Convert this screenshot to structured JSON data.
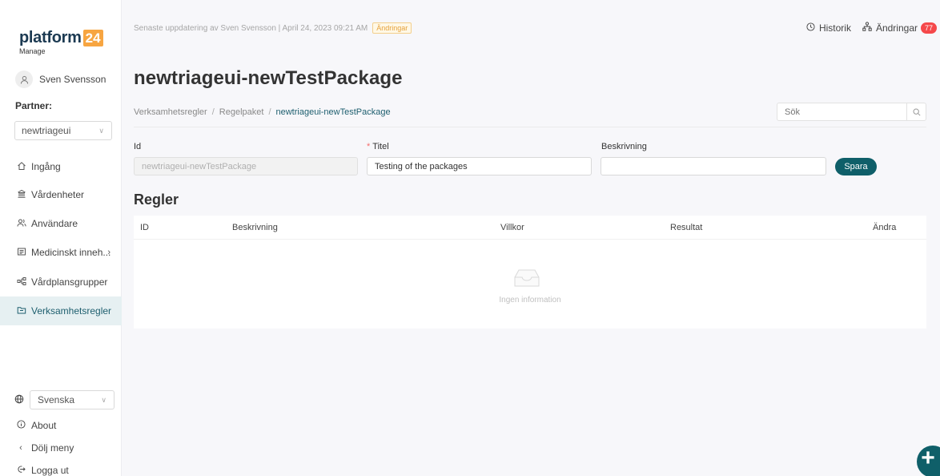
{
  "brand": {
    "word": "platform",
    "number": "24",
    "sub": "Manage",
    "accent": "#f7a541"
  },
  "user": {
    "avatar_icon": "user-icon",
    "name": "Sven Svensson"
  },
  "partner": {
    "label": "Partner:",
    "selected": "newtriageui"
  },
  "nav": [
    {
      "icon": "home-icon",
      "label": "Ingång"
    },
    {
      "icon": "bank-icon",
      "label": "Vårdenheter"
    },
    {
      "icon": "users-icon",
      "label": "Användare"
    },
    {
      "icon": "book-icon",
      "label": "Medicinskt inneh...",
      "has_submenu": true
    },
    {
      "icon": "tree-icon",
      "label": "Vårdplansgrupper"
    },
    {
      "icon": "folder-icon",
      "label": "Verksamhetsregler",
      "active": true
    }
  ],
  "footer": {
    "language": "Svenska",
    "about": "About",
    "hide_menu": "Dölj meny",
    "logout": "Logga ut"
  },
  "topbar": {
    "last_update": "Senaste uppdatering av Sven Svensson | April 24, 2023 09:21 AM",
    "changes_tag": "Ändringar",
    "history": "Historik",
    "changes": "Ändringar",
    "changes_count": "77"
  },
  "page": {
    "title": "newtriageui-newTestPackage",
    "breadcrumb": [
      "Verksamhetsregler",
      "Regelpaket",
      "newtriageui-newTestPackage"
    ],
    "search_placeholder": "Sök"
  },
  "form": {
    "id_label": "Id",
    "id_value": "newtriageui-newTestPackage",
    "title_required": "*",
    "title_label": "Titel",
    "title_value": "Testing of the packages",
    "description_label": "Beskrivning",
    "description_value": "",
    "save": "Spara"
  },
  "rules": {
    "heading": "Regler",
    "columns": [
      "ID",
      "Beskrivning",
      "Villkor",
      "Resultat",
      "Ändra"
    ],
    "rows": [],
    "empty_text": "Ingen information"
  },
  "fab_label": "+",
  "colors": {
    "primary": "#0f5f69",
    "badge": "#f5484a",
    "active_bg": "#e6f0f2"
  }
}
